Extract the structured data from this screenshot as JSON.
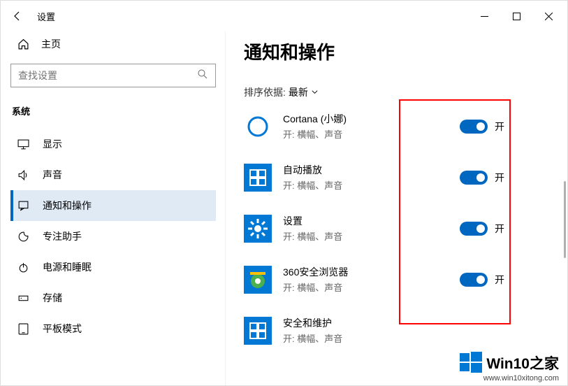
{
  "titlebar": {
    "title": "设置"
  },
  "sidebar": {
    "home": "主页",
    "search_placeholder": "查找设置",
    "category": "系统",
    "items": [
      {
        "label": "显示"
      },
      {
        "label": "声音"
      },
      {
        "label": "通知和操作"
      },
      {
        "label": "专注助手"
      },
      {
        "label": "电源和睡眠"
      },
      {
        "label": "存储"
      },
      {
        "label": "平板模式"
      }
    ]
  },
  "main": {
    "heading": "通知和操作",
    "sort_label": "排序依据:",
    "sort_value": "最新",
    "apps": [
      {
        "name": "Cortana (小娜)",
        "sub": "开: 横幅、声音",
        "toggle_label": "开"
      },
      {
        "name": "自动播放",
        "sub": "开: 横幅、声音",
        "toggle_label": "开"
      },
      {
        "name": "设置",
        "sub": "开: 横幅、声音",
        "toggle_label": "开"
      },
      {
        "name": "360安全浏览器",
        "sub": "开: 横幅、声音",
        "toggle_label": "开"
      },
      {
        "name": "安全和维护",
        "sub": "开: 横幅、声音",
        "toggle_label": ""
      }
    ]
  },
  "watermark": {
    "brand": "Win10之家",
    "url": "www.win10xitong.com"
  }
}
